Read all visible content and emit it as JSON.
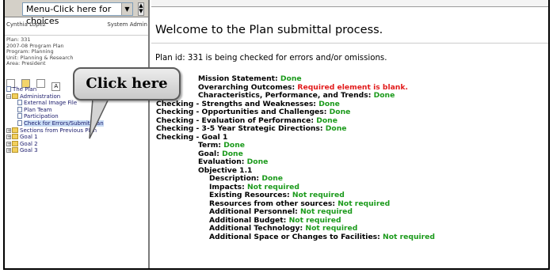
{
  "menu": {
    "select_value": "Menu-Click here for choices"
  },
  "user": {
    "name": "Cynthia Lopez",
    "role": "System Admin"
  },
  "plan_info": [
    "Plan: 331",
    "2007-08 Program Plan",
    "Program: Planning",
    "Unit: Planning & Research",
    "Area: President"
  ],
  "toolbar": {
    "icons": [
      "page-icon",
      "folder-icon",
      "edit-icon",
      "add-icon"
    ],
    "labels": [
      "",
      "",
      "",
      "A"
    ]
  },
  "tree": {
    "root": "The Plan",
    "admin": "Administration",
    "admin_items": [
      "External Image File",
      "Plan Team",
      "Participation",
      "Check for Errors/Submit Plan"
    ],
    "sections": "Sections from Previous Plan",
    "goals": [
      "Goal 1",
      "Goal 2",
      "Goal 3"
    ]
  },
  "callout": {
    "text": "Click here"
  },
  "main": {
    "title": "Welcome to the Plan submittal process.",
    "plan_id_text": "Plan id: 331 is being checked for errors and/or omissions.",
    "log": [
      {
        "label": "Mission Statement:",
        "status": "Done",
        "kind": "ok",
        "indent": 2
      },
      {
        "label": "Overarching Outcomes:",
        "status": "Required element is blank.",
        "kind": "err",
        "indent": 2
      },
      {
        "label": "Characteristics, Performance, and Trends:",
        "status": "Done",
        "kind": "ok",
        "indent": 2
      },
      {
        "label": "Checking - Strengths and Weaknesses:",
        "status": "Done",
        "kind": "ok",
        "indent": 1
      },
      {
        "label": "Checking - Opportunities and Challenges:",
        "status": "Done",
        "kind": "ok",
        "indent": 1
      },
      {
        "label": "Checking - Evaluation of Performance:",
        "status": "Done",
        "kind": "ok",
        "indent": 1
      },
      {
        "label": "Checking - 3-5 Year Strategic Directions:",
        "status": "Done",
        "kind": "ok",
        "indent": 1
      },
      {
        "label": "Checking - Goal 1",
        "status": "",
        "kind": "ok",
        "indent": 1
      },
      {
        "label": "Term:",
        "status": "Done",
        "kind": "ok",
        "indent": 3
      },
      {
        "label": "Goal:",
        "status": "Done",
        "kind": "ok",
        "indent": 3
      },
      {
        "label": "Evaluation:",
        "status": "Done",
        "kind": "ok",
        "indent": 3
      },
      {
        "label": "Objective 1.1",
        "status": "",
        "kind": "ok",
        "indent": 3
      },
      {
        "label": "Description:",
        "status": "Done",
        "kind": "ok",
        "indent": 4
      },
      {
        "label": "Impacts:",
        "status": "Not required",
        "kind": "ok",
        "indent": 4
      },
      {
        "label": "Existing Resources:",
        "status": "Not required",
        "kind": "ok",
        "indent": 4
      },
      {
        "label": "Resources from other sources:",
        "status": "Not required",
        "kind": "ok",
        "indent": 4
      },
      {
        "label": "Additional Personnel:",
        "status": "Not required",
        "kind": "ok",
        "indent": 4
      },
      {
        "label": "Additional Budget:",
        "status": "Not required",
        "kind": "ok",
        "indent": 4
      },
      {
        "label": "Additional Technology:",
        "status": "Not required",
        "kind": "ok",
        "indent": 4
      },
      {
        "label": "Additional Space or Changes to Facilities:",
        "status": "Not required",
        "kind": "ok",
        "indent": 4
      }
    ]
  },
  "colors": {
    "ok": "#1b9a1b",
    "err": "#e21b1b",
    "folder": "#f2cf5c"
  }
}
